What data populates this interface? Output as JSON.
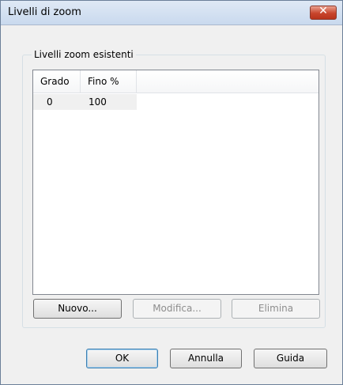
{
  "window": {
    "title": "Livelli di zoom"
  },
  "group": {
    "label": "Livelli zoom esistenti"
  },
  "list": {
    "columns": [
      "Grado",
      "Fino %"
    ],
    "rows": [
      [
        "0",
        "100"
      ]
    ]
  },
  "list_buttons": {
    "new": "Nuovo...",
    "edit": "Modifica...",
    "delete": "Elimina"
  },
  "footer": {
    "ok": "OK",
    "cancel": "Annulla",
    "help": "Guida"
  }
}
